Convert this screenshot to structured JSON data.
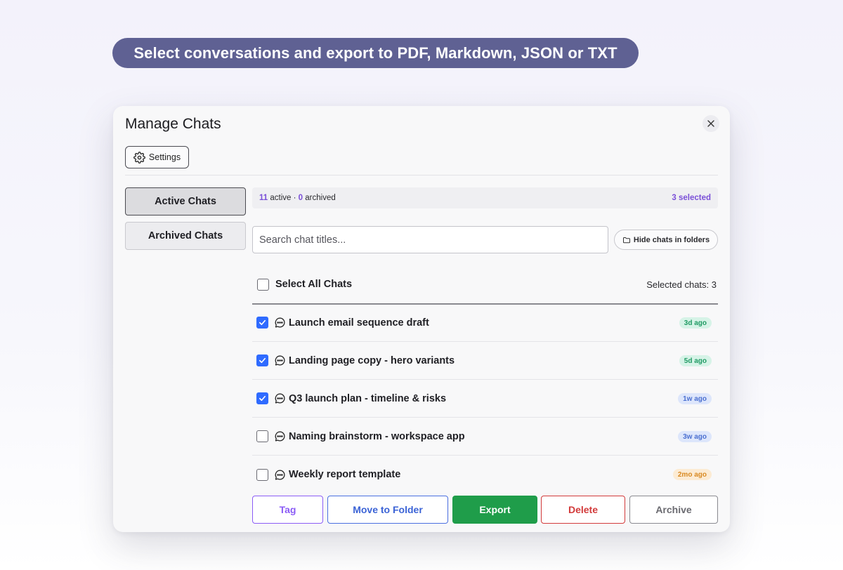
{
  "banner": {
    "text": "Select conversations and export to PDF, Markdown, JSON or TXT"
  },
  "modal": {
    "title": "Manage Chats",
    "settings_label": "Settings"
  },
  "sidebar": {
    "tabs": [
      {
        "label": "Active Chats",
        "active": true
      },
      {
        "label": "Archived Chats",
        "active": false
      }
    ]
  },
  "stats": {
    "active_count": "11",
    "active_label": "active ·",
    "archived_count": "0",
    "archived_label": "archived",
    "selected_text": "3 selected"
  },
  "search": {
    "placeholder": "Search chat titles..."
  },
  "hide_folders": {
    "label": "Hide chats in folders"
  },
  "select_all": {
    "label": "Select All Chats",
    "selected_count_text": "Selected chats: 3"
  },
  "chats": [
    {
      "title": "Launch email sequence draft",
      "checked": true,
      "age": "3d ago",
      "badge_color": "green"
    },
    {
      "title": "Landing page copy - hero variants",
      "checked": true,
      "age": "5d ago",
      "badge_color": "green"
    },
    {
      "title": "Q3 launch plan - timeline & risks",
      "checked": true,
      "age": "1w ago",
      "badge_color": "blue"
    },
    {
      "title": "Naming brainstorm - workspace app",
      "checked": false,
      "age": "3w ago",
      "badge_color": "blue"
    },
    {
      "title": "Weekly report template",
      "checked": false,
      "age": "2mo ago",
      "badge_color": "orange"
    }
  ],
  "actions": {
    "tag": "Tag",
    "move": "Move to Folder",
    "export": "Export",
    "delete": "Delete",
    "archive": "Archive"
  },
  "colors": {
    "accent_purple": "#7a4fd8",
    "checkbox_blue": "#2f6bff",
    "export_green": "#1f9d4a",
    "delete_red": "#d23a3a"
  }
}
